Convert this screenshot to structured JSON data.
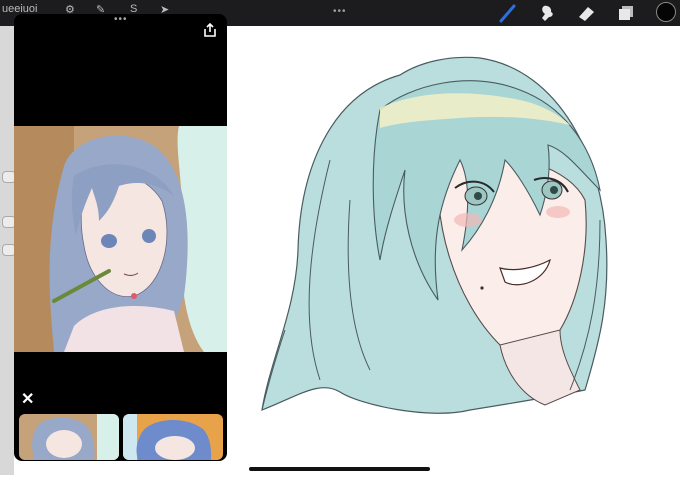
{
  "topbar": {
    "left_text": "ueeiuoi",
    "dots": "•••",
    "tools": [
      {
        "name": "brush-icon",
        "active": true
      },
      {
        "name": "smudge-icon",
        "active": false
      },
      {
        "name": "eraser-icon",
        "active": false
      },
      {
        "name": "layers-icon",
        "active": false
      }
    ],
    "color": "#050505",
    "accent": "#2b6fe0"
  },
  "reference": {
    "dots": "•••",
    "export_icon": "share-icon",
    "close_icon": "close-icon",
    "close_label": "✕"
  }
}
